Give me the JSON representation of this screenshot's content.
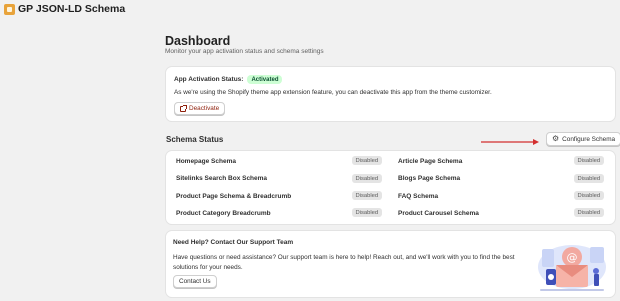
{
  "app": {
    "title": "GP JSON-LD Schema"
  },
  "page": {
    "title": "Dashboard",
    "subtitle": "Monitor your app activation status and schema settings"
  },
  "activation": {
    "label": "App Activation Status:",
    "badge": "Activated",
    "description": "As we're using the Shopify theme app extension feature, you can deactivate this app from the theme customizer.",
    "deactivate_label": "Deactivate"
  },
  "schema_status": {
    "title": "Schema Status",
    "configure_label": "Configure Schema",
    "items": [
      {
        "name": "Homepage Schema",
        "status": "Disabled"
      },
      {
        "name": "Article Page Schema",
        "status": "Disabled"
      },
      {
        "name": "Sitelinks Search Box Schema",
        "status": "Disabled"
      },
      {
        "name": "Blogs Page Schema",
        "status": "Disabled"
      },
      {
        "name": "Product Page Schema & Breadcrumb",
        "status": "Disabled"
      },
      {
        "name": "FAQ Schema",
        "status": "Disabled"
      },
      {
        "name": "Product Category Breadcrumb",
        "status": "Disabled"
      },
      {
        "name": "Product Carousel Schema",
        "status": "Disabled"
      }
    ]
  },
  "support": {
    "title": "Need Help? Contact Our Support Team",
    "description": "Have questions or need assistance? Our support team is here to help! Reach out, and we'll work with you to find the best solutions for your needs.",
    "contact_label": "Contact Us"
  },
  "colors": {
    "accent": "#e8a33a",
    "activated_bg": "#cdfed4",
    "activated_text": "#0c5132",
    "arrow": "#d32f2f",
    "deactivate": "#8e1f0b"
  }
}
